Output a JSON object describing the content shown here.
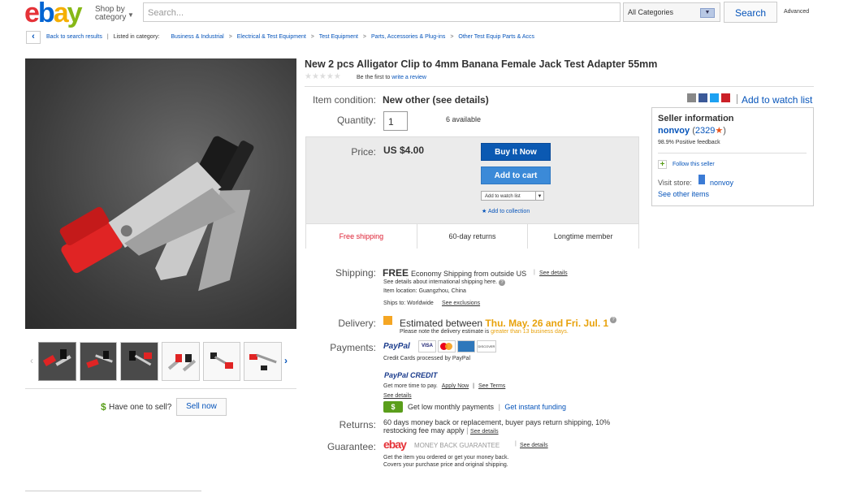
{
  "header": {
    "logo_letters": [
      "e",
      "b",
      "a",
      "y"
    ],
    "shop_by_line1": "Shop by",
    "shop_by_line2": "category",
    "search_placeholder": "Search...",
    "category_value": "All Categories",
    "search_button": "Search",
    "advanced": "Advanced"
  },
  "breadcrumb": {
    "back": "Back to search results",
    "listed_in": "Listed in category:",
    "items": [
      "Business & Industrial",
      "Electrical & Test Equipment",
      "Test Equipment",
      "Parts, Accessories & Plug-ins",
      "Other Test Equip Parts & Accs"
    ]
  },
  "product": {
    "title": "New 2 pcs Alligator Clip to 4mm Banana Female Jack Test Adapter 55mm",
    "stars": "★★★★★",
    "review_prefix": "Be the first to ",
    "review_link": "write a review",
    "condition_label": "Item condition:",
    "condition_value": "New other (see details)",
    "quantity_label": "Quantity:",
    "quantity_value": "1",
    "available": "6 available",
    "price_label": "Price:",
    "price_value": "US $4.00",
    "buy_it_now": "Buy It Now",
    "add_to_cart": "Add to cart",
    "add_to_watch_list_small": "Add to watch list",
    "add_to_collection": "Add to collection",
    "features": [
      "Free shipping",
      "60-day returns",
      "Longtime member"
    ],
    "add_to_watch_list": "Add to watch list"
  },
  "seller": {
    "heading": "Seller information",
    "name": "nonvoy",
    "score": "2329",
    "feedback": "98.9% Positive feedback",
    "follow": "Follow this seller",
    "visit_store_label": "Visit store:",
    "store_name": "nonvoy",
    "see_other": "See other items"
  },
  "shipping": {
    "label": "Shipping:",
    "free": "FREE",
    "method": "Economy Shipping from outside US",
    "see_details": "See details",
    "intl_note": "See details about international shipping here.",
    "location": "Item location: Guangzhou, China",
    "ships_to": "Ships to: Worldwide",
    "see_exclusions": "See exclusions"
  },
  "delivery": {
    "label": "Delivery:",
    "estimated": "Estimated between",
    "dates": "Thu. May. 26 and Fri. Jul. 1",
    "note_prefix": "Please note the delivery estimate is ",
    "note_highlight": "greater than 13 business days."
  },
  "payments": {
    "label": "Payments:",
    "paypal": "PayPal",
    "cards": [
      "VISA",
      "MC",
      "AMEX",
      "DISCOVER"
    ],
    "credit_cards_note": "Credit Cards processed by PayPal",
    "paypal_credit": "PayPal CREDIT",
    "more_time": "Get more time to pay.",
    "apply_now": "Apply Now",
    "see_terms": "See Terms",
    "see_details": "See details",
    "monthly": "Get low monthly payments",
    "instant_funding": "Get instant funding"
  },
  "returns": {
    "label": "Returns:",
    "text": "60 days money back or replacement, buyer pays return shipping, 10% restocking fee may apply",
    "see_details": "See details"
  },
  "guarantee": {
    "label": "Guarantee:",
    "brand": "ebay",
    "badge": "MONEY BACK GUARANTEE",
    "see_details": "See details",
    "line1": "Get the item you ordered or get your money back.",
    "line2": "Covers your purchase price and original shipping."
  },
  "sell": {
    "dollar": "$",
    "question": "Have one to sell?",
    "button": "Sell now"
  },
  "colors": {
    "brand_blue": "#0654ba",
    "buy_now": "#0b59b2",
    "add_cart": "#3b8ad8",
    "free_red": "#dd1e31",
    "orange": "#f5a623"
  }
}
